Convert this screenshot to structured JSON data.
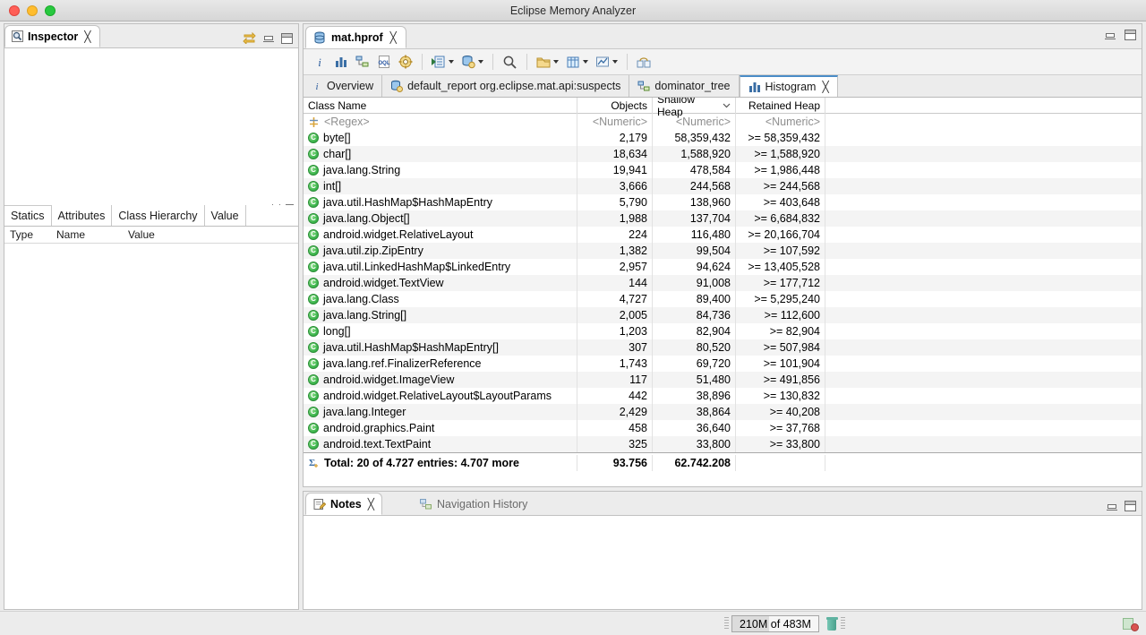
{
  "window": {
    "title": "Eclipse Memory Analyzer",
    "traffic_lights": [
      "close",
      "minimize",
      "zoom"
    ]
  },
  "inspector": {
    "tab_label": "Inspector",
    "tab_icon": "inspector-icon",
    "toolbar_icons": [
      "link-with-editor-icon",
      "minimize-icon",
      "maximize-icon"
    ],
    "sub_tabs": [
      {
        "label": "Statics",
        "active": true
      },
      {
        "label": "Attributes",
        "active": false
      },
      {
        "label": "Class Hierarchy",
        "active": false
      },
      {
        "label": "Value",
        "active": false
      }
    ],
    "columns": [
      "Type",
      "Name",
      "Value"
    ]
  },
  "editor": {
    "tab_label": "mat.hprof",
    "tab_icon": "heap-dump-icon",
    "toolbar": [
      {
        "name": "info-icon",
        "glyph": "i"
      },
      {
        "name": "histogram-icon",
        "glyph": "bars"
      },
      {
        "name": "dominator-tree-icon",
        "glyph": "tree"
      },
      {
        "name": "oql-icon",
        "glyph": "OQL"
      },
      {
        "name": "leak-suspects-icon",
        "glyph": "gear"
      },
      {
        "name": "run-query-icon",
        "glyph": "console",
        "has_dropdown": true
      },
      {
        "name": "heap-objects-icon",
        "glyph": "db",
        "has_dropdown": true
      },
      {
        "name": "search-icon",
        "glyph": "magnifier"
      },
      {
        "name": "group-by-icon",
        "glyph": "folder",
        "has_dropdown": true
      },
      {
        "name": "table-view-icon",
        "glyph": "table",
        "has_dropdown": true
      },
      {
        "name": "export-chart-icon",
        "glyph": "chart",
        "has_dropdown": true
      },
      {
        "name": "compare-icon",
        "glyph": "compare"
      }
    ],
    "view_tabs": [
      {
        "label": "Overview",
        "icon": "info-icon",
        "active": false
      },
      {
        "label": "default_report org.eclipse.mat.api:suspects",
        "icon": "report-icon",
        "active": false
      },
      {
        "label": "dominator_tree",
        "icon": "dominator-tree-icon",
        "active": false
      },
      {
        "label": "Histogram",
        "icon": "histogram-icon",
        "active": true,
        "closable": true
      }
    ],
    "minimize_label": "minimize",
    "maximize_label": "maximize"
  },
  "histogram": {
    "columns": [
      {
        "label": "Class Name",
        "align": "left"
      },
      {
        "label": "Objects",
        "align": "right"
      },
      {
        "label": "Shallow Heap",
        "align": "right",
        "sorted": "desc"
      },
      {
        "label": "Retained Heap",
        "align": "right"
      }
    ],
    "filter_row": {
      "class_name": "<Regex>",
      "objects": "<Numeric>",
      "shallow": "<Numeric>",
      "retained": "<Numeric>"
    },
    "rows": [
      {
        "class_name": "byte[]",
        "objects": "2,179",
        "shallow": "58,359,432",
        "retained": ">= 58,359,432"
      },
      {
        "class_name": "char[]",
        "objects": "18,634",
        "shallow": "1,588,920",
        "retained": ">= 1,588,920"
      },
      {
        "class_name": "java.lang.String",
        "objects": "19,941",
        "shallow": "478,584",
        "retained": ">= 1,986,448"
      },
      {
        "class_name": "int[]",
        "objects": "3,666",
        "shallow": "244,568",
        "retained": ">= 244,568"
      },
      {
        "class_name": "java.util.HashMap$HashMapEntry",
        "objects": "5,790",
        "shallow": "138,960",
        "retained": ">= 403,648"
      },
      {
        "class_name": "java.lang.Object[]",
        "objects": "1,988",
        "shallow": "137,704",
        "retained": ">= 6,684,832"
      },
      {
        "class_name": "android.widget.RelativeLayout",
        "objects": "224",
        "shallow": "116,480",
        "retained": ">= 20,166,704"
      },
      {
        "class_name": "java.util.zip.ZipEntry",
        "objects": "1,382",
        "shallow": "99,504",
        "retained": ">= 107,592"
      },
      {
        "class_name": "java.util.LinkedHashMap$LinkedEntry",
        "objects": "2,957",
        "shallow": "94,624",
        "retained": ">= 13,405,528"
      },
      {
        "class_name": "android.widget.TextView",
        "objects": "144",
        "shallow": "91,008",
        "retained": ">= 177,712"
      },
      {
        "class_name": "java.lang.Class",
        "objects": "4,727",
        "shallow": "89,400",
        "retained": ">= 5,295,240"
      },
      {
        "class_name": "java.lang.String[]",
        "objects": "2,005",
        "shallow": "84,736",
        "retained": ">= 112,600"
      },
      {
        "class_name": "long[]",
        "objects": "1,203",
        "shallow": "82,904",
        "retained": ">= 82,904"
      },
      {
        "class_name": "java.util.HashMap$HashMapEntry[]",
        "objects": "307",
        "shallow": "80,520",
        "retained": ">= 507,984"
      },
      {
        "class_name": "java.lang.ref.FinalizerReference",
        "objects": "1,743",
        "shallow": "69,720",
        "retained": ">= 101,904"
      },
      {
        "class_name": "android.widget.ImageView",
        "objects": "117",
        "shallow": "51,480",
        "retained": ">= 491,856"
      },
      {
        "class_name": "android.widget.RelativeLayout$LayoutParams",
        "objects": "442",
        "shallow": "38,896",
        "retained": ">= 130,832"
      },
      {
        "class_name": "java.lang.Integer",
        "objects": "2,429",
        "shallow": "38,864",
        "retained": ">= 40,208"
      },
      {
        "class_name": "android.graphics.Paint",
        "objects": "458",
        "shallow": "36,640",
        "retained": ">= 37,768"
      },
      {
        "class_name": "android.text.TextPaint",
        "objects": "325",
        "shallow": "33,800",
        "retained": ">= 33,800"
      }
    ],
    "total_row": {
      "label": "Total: 20 of 4.727 entries: 4.707 more",
      "objects": "93.756",
      "shallow": "62.742.208",
      "retained": ""
    }
  },
  "notes_panel": {
    "tabs": [
      {
        "label": "Notes",
        "icon": "notes-icon",
        "active": true,
        "closable": true
      },
      {
        "label": "Navigation History",
        "icon": "navigation-history-icon",
        "active": false
      }
    ]
  },
  "status_bar": {
    "heap_label": "210M of 483M",
    "heap_used_percent": 43,
    "gc_icon": "trash-icon",
    "right_icon": "status-indicator-icon"
  }
}
